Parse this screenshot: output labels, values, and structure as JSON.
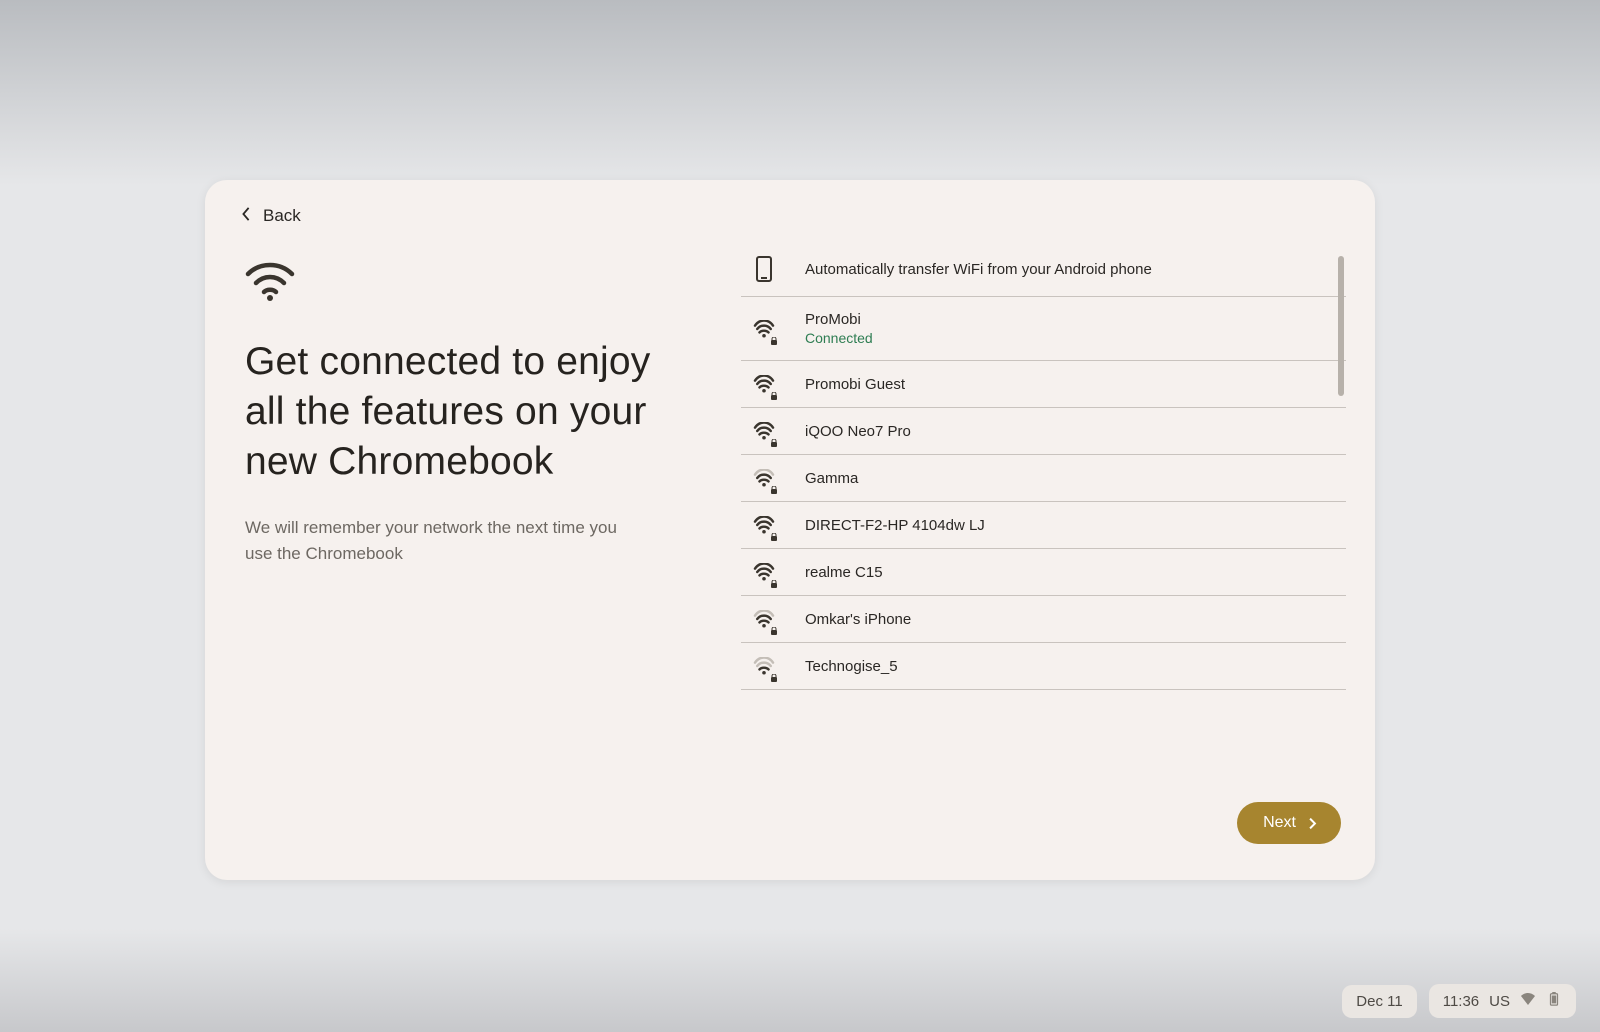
{
  "back_label": "Back",
  "title": "Get connected to enjoy all the features on your new Chromebook",
  "subtitle": "We will remember your network the next time you use the Chromebook",
  "transfer_option": "Automatically transfer WiFi from your Android phone",
  "connected_label": "Connected",
  "networks": [
    {
      "ssid": "ProMobi",
      "connected": true,
      "secured": true,
      "strength": 3
    },
    {
      "ssid": "Promobi Guest",
      "connected": false,
      "secured": true,
      "strength": 3
    },
    {
      "ssid": "iQOO Neo7 Pro",
      "connected": false,
      "secured": true,
      "strength": 3
    },
    {
      "ssid": "Gamma",
      "connected": false,
      "secured": true,
      "strength": 2
    },
    {
      "ssid": "DIRECT-F2-HP 4104dw LJ",
      "connected": false,
      "secured": true,
      "strength": 3
    },
    {
      "ssid": "realme C15",
      "connected": false,
      "secured": true,
      "strength": 3
    },
    {
      "ssid": "Omkar's iPhone",
      "connected": false,
      "secured": true,
      "strength": 2
    },
    {
      "ssid": "Technogise_5",
      "connected": false,
      "secured": true,
      "strength": 1
    }
  ],
  "next_label": "Next",
  "status": {
    "date": "Dec 11",
    "time": "11:36",
    "kbd": "US"
  }
}
